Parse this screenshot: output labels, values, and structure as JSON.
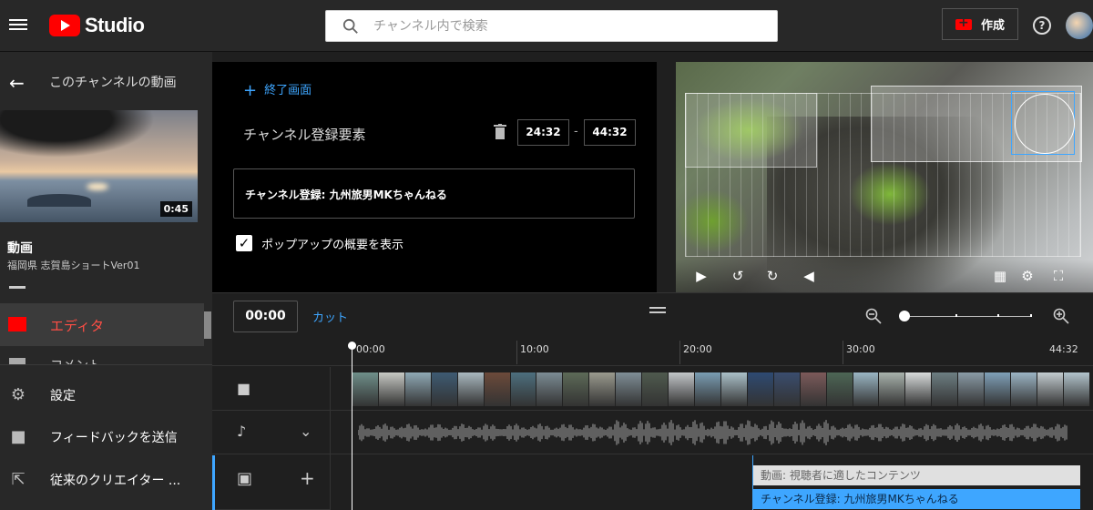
{
  "header": {
    "logo_text": "Studio",
    "search_placeholder": "チャンネル内で検索",
    "create_label": "作成",
    "help_label": "?"
  },
  "sidebar": {
    "back_label": "このチャンネルの動画",
    "thumbnail_duration": "0:45",
    "video_heading": "動画",
    "video_title": "福岡県 志賀島ショートVer01",
    "active_item": "エディタ",
    "partial_item": "コメント",
    "bottom_items": [
      {
        "label": "設定",
        "icon": "gear-icon"
      },
      {
        "label": "フィードバックを送信",
        "icon": "feedback-icon"
      },
      {
        "label": "従来のクリエイター ...",
        "icon": "exit-icon"
      }
    ]
  },
  "editor": {
    "endscreen_link": "終了画面",
    "element_type": "チャンネル登録要素",
    "start_time": "24:32",
    "dash": "-",
    "end_time": "44:32",
    "element_name": "チャンネル登録: 九州旅男MKちゃんねる",
    "popup_checkbox_label": "ポップアップの概要を表示",
    "popup_checked": true
  },
  "timeline": {
    "current_time": "00:00",
    "cut_label": "カット",
    "ruler": [
      "00:00",
      "10:00",
      "20:00",
      "30:00",
      "44:32"
    ],
    "zoom_level_fraction": 0.0,
    "endscreen_items": [
      "動画: 視聴者に適したコンテンツ",
      "チャンネル登録: 九州旅男MKちゃんねる"
    ],
    "frame_colors": [
      "#6f8f8a",
      "#c7c9c4",
      "#8fa9b5",
      "#3e5b73",
      "#a9b8bf",
      "#6c4a3a",
      "#4d6f7e",
      "#7c8c94",
      "#5d6a58",
      "#9a9a8e",
      "#7f8e96",
      "#4f5a4e",
      "#c2c6c8",
      "#7a9db3",
      "#aac0c8",
      "#2e4a72",
      "#3a4d6e",
      "#7c5a5a",
      "#4d6655",
      "#9ab6c4",
      "#a8b2ac",
      "#d8dcdc",
      "#6d7e82",
      "#8a9ba6",
      "#7fa0b8",
      "#9bb4c4",
      "#c3ccd0",
      "#b2c4cc"
    ],
    "accent_color": "#3ea6ff",
    "active_color": "#ff4e45"
  }
}
